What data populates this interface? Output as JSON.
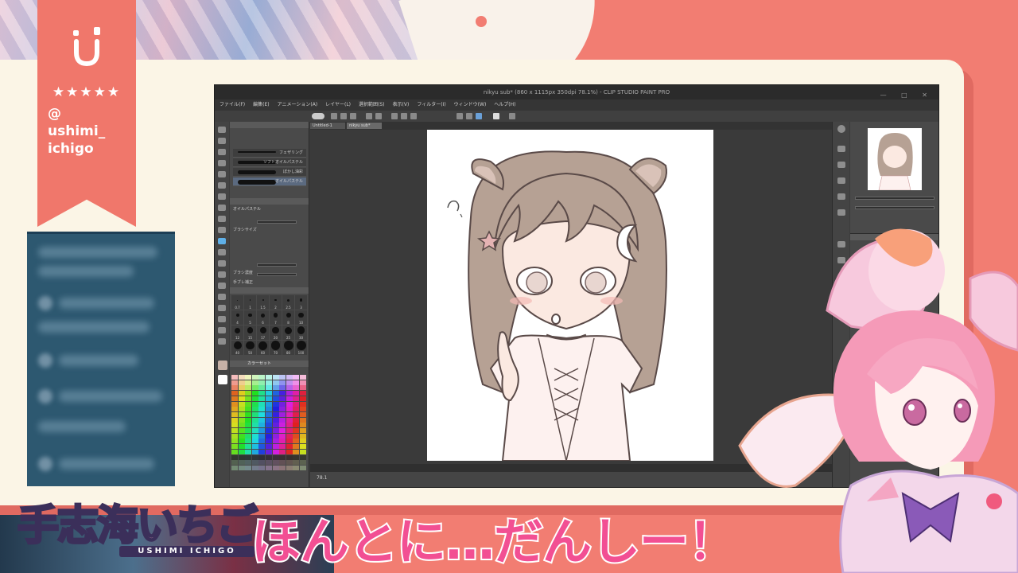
{
  "overlay": {
    "profile": {
      "stars": "★★★★★",
      "at": "@",
      "handle_line1": "ushimi_",
      "handle_line2": "ichigo"
    },
    "logo": {
      "title": "手志海いちご",
      "subtitle": "USHIMI ICHIGO"
    },
    "caption": "ほんとに…だんしー！",
    "colors": {
      "coral": "#f27d72",
      "cream": "#fbf5e6",
      "caption_pink": "#f24f93",
      "chat_blue": "#2d5870"
    }
  },
  "csp": {
    "title": "nikyu sub* (860 x 1115px 350dpi 78.1%) - CLIP STUDIO PAINT PRO",
    "window_controls": "— □ ✕",
    "menu": [
      "ファイル(F)",
      "編集(E)",
      "アニメーション(A)",
      "レイヤー(L)",
      "選択範囲(S)",
      "表示(V)",
      "フィルター(I)",
      "ウィンドウ(W)",
      "ヘルプ(H)"
    ],
    "doc_tabs": [
      "Untitled-1",
      "nikyu sub*"
    ],
    "subtool_brushes": [
      "フェザリング",
      "ソフトオイルパステル",
      "ぼかし油彩",
      "オイルパステル"
    ],
    "brush_preview_label": "オイルパステル",
    "props": [
      "ブラシサイズ",
      "ブラシ濃度",
      "手ブレ補正"
    ],
    "brush_sizes": [
      "0.7",
      "1",
      "1.5",
      "2",
      "2.5",
      "3",
      "4",
      "5",
      "6",
      "7",
      "8",
      "10",
      "12",
      "15",
      "17",
      "20",
      "25",
      "30",
      "40",
      "50",
      "60",
      "70",
      "80",
      "100"
    ],
    "color_set_label": "カラーセット",
    "zoom": "78.1"
  }
}
